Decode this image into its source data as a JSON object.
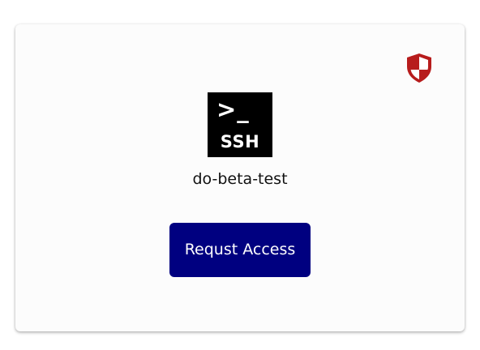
{
  "resource": {
    "name": "do-beta-test",
    "logo": {
      "prompt": ">_",
      "label": "SSH",
      "icon": "ssh-terminal-icon"
    }
  },
  "actions": {
    "request_label": "Requst Access"
  },
  "status": {
    "icon": "shield-icon"
  },
  "colors": {
    "button_bg": "#000080",
    "shield": "#b71c1c",
    "card_bg": "#fcfcfc"
  }
}
